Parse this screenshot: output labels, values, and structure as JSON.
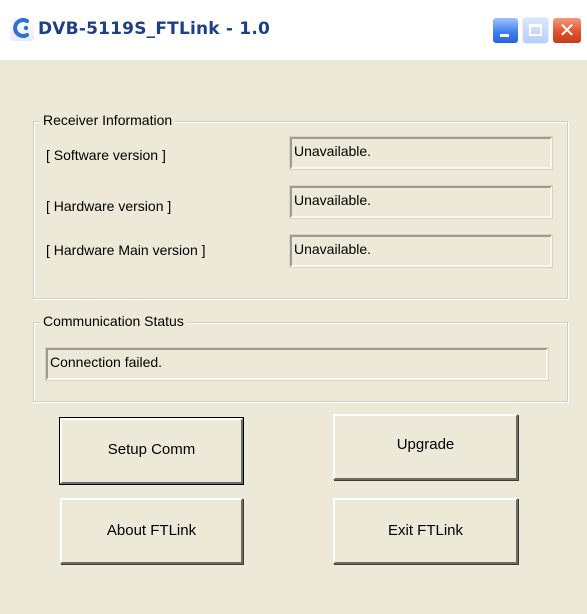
{
  "window": {
    "title": "DVB-5119S_FTLink - 1.0",
    "title_color": "#1c3f8a",
    "background": "#ECE9D8",
    "controls": {
      "minimize_icon": "minimize-icon",
      "maximize_icon": "maximize-icon",
      "close_icon": "close-icon",
      "close_glyph": "✕"
    }
  },
  "receiver_info": {
    "label": "Receiver Information",
    "rows": [
      {
        "label": "[ Software version ]",
        "value": "Unavailable."
      },
      {
        "label": "[ Hardware version ]",
        "value": "Unavailable."
      },
      {
        "label": "[ Hardware Main version ]",
        "value": "Unavailable."
      }
    ]
  },
  "communication": {
    "label": "Communication Status",
    "status": "Connection failed."
  },
  "buttons": {
    "setup_comm": "Setup Comm",
    "upgrade": "Upgrade",
    "about": "About FTLink",
    "exit": "Exit FTLink"
  }
}
